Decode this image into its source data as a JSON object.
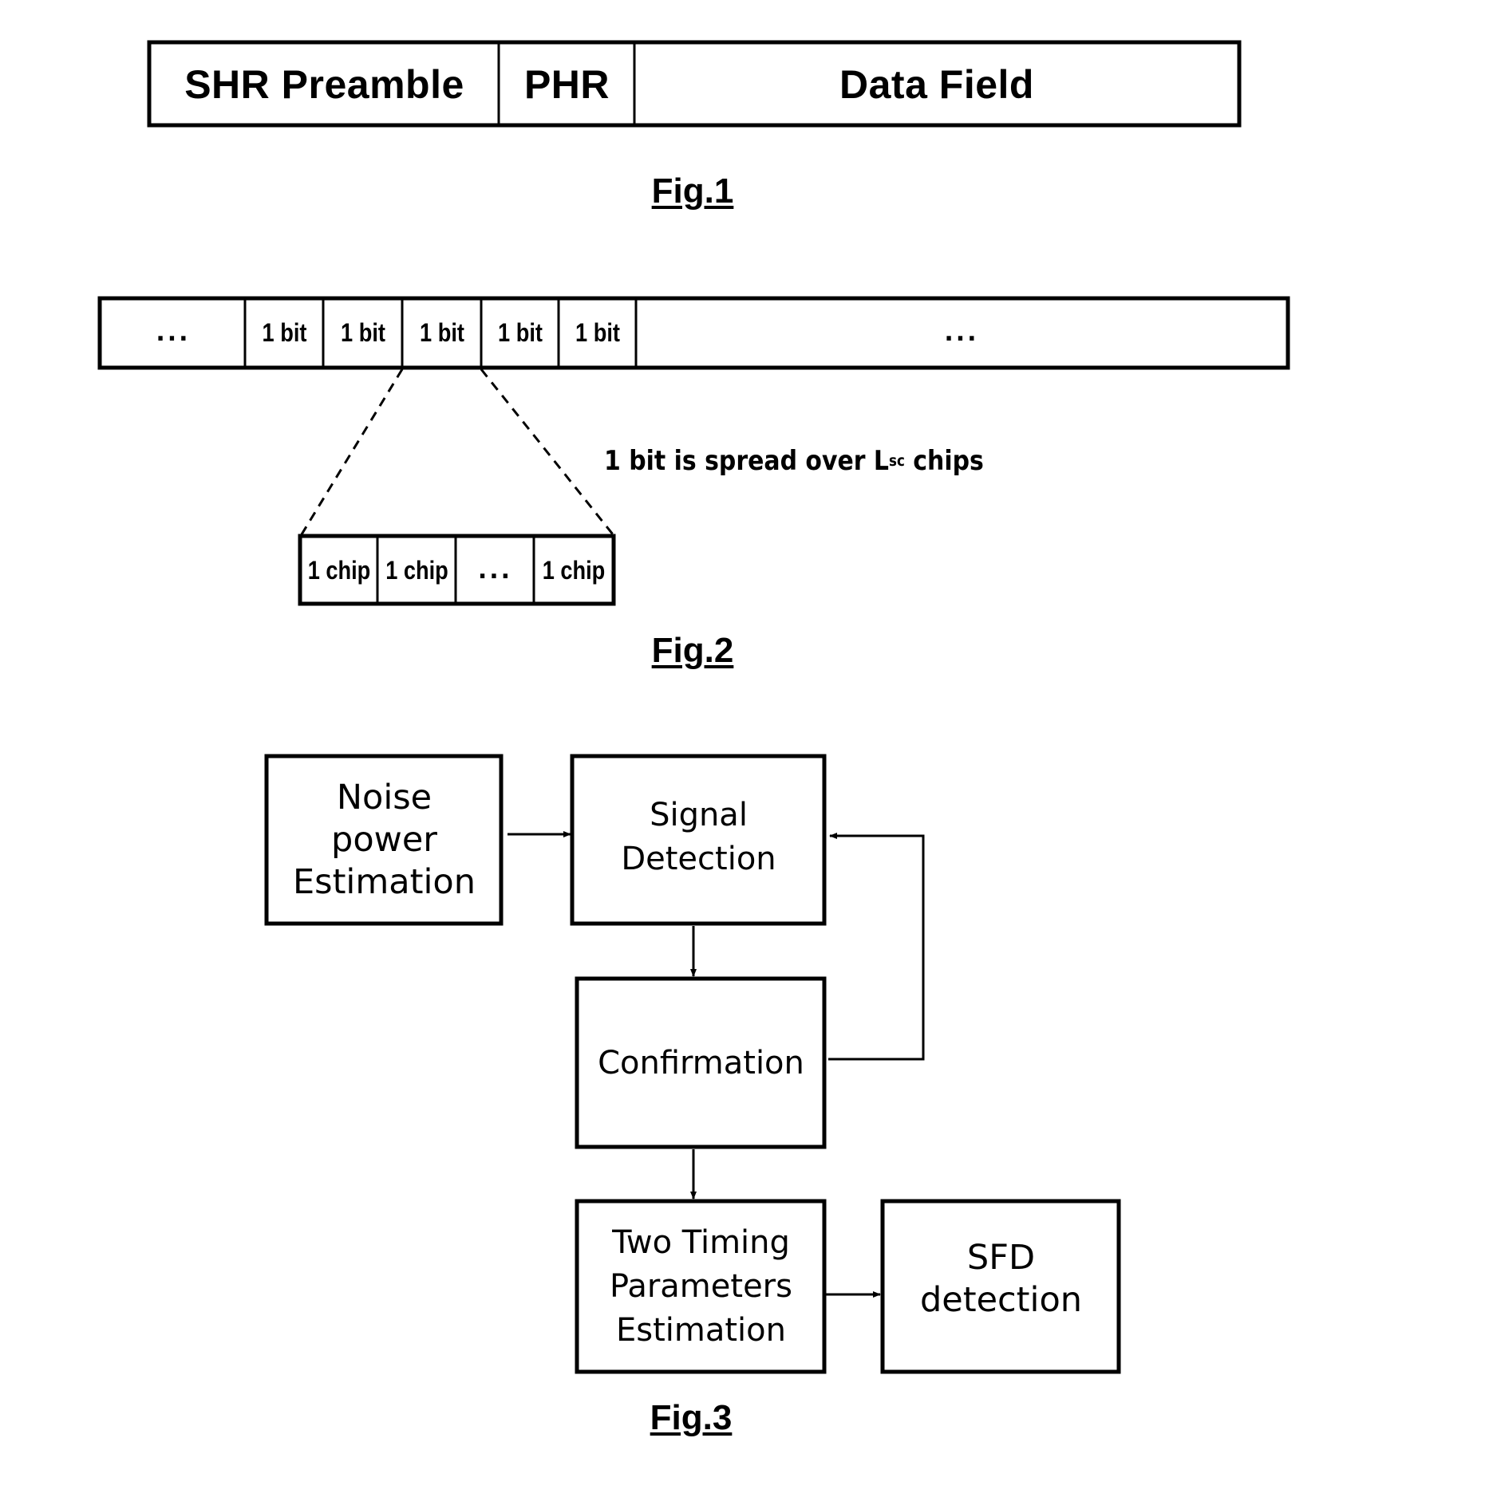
{
  "fig1": {
    "caption": "Fig.1",
    "fields": [
      {
        "label": "SHR Preamble"
      },
      {
        "label": "PHR"
      },
      {
        "label": "Data Field"
      }
    ]
  },
  "fig2": {
    "caption": "Fig.2",
    "bits": [
      "...",
      "1 bit",
      "1 bit",
      "1 bit",
      "1 bit",
      "1 bit",
      "..."
    ],
    "chips": [
      "1 chip",
      "1 chip",
      "...",
      "1 chip"
    ],
    "annotation": {
      "prefix": "1 bit is spread over L",
      "subscript": "sc",
      "suffix": " chips"
    }
  },
  "fig3": {
    "caption": "Fig.3",
    "blocks": {
      "noise": [
        "Noise",
        "power",
        "Estimation"
      ],
      "signal": [
        "Signal",
        "Detection"
      ],
      "confirmation": [
        "Confirmation"
      ],
      "timing": [
        "Two Timing",
        "Parameters",
        "Estimation"
      ],
      "sfd": [
        "SFD",
        "detection"
      ]
    },
    "edges": [
      {
        "from": "noise",
        "to": "signal"
      },
      {
        "from": "signal",
        "to": "confirmation"
      },
      {
        "from": "confirmation",
        "to": "signal",
        "kind": "feedback"
      },
      {
        "from": "confirmation",
        "to": "timing"
      },
      {
        "from": "timing",
        "to": "sfd"
      }
    ]
  }
}
